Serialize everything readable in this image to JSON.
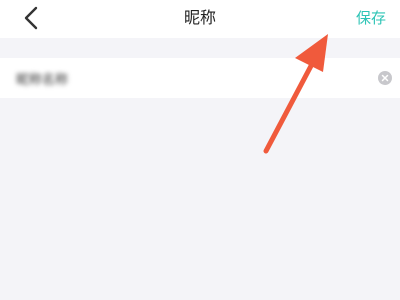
{
  "header": {
    "title": "昵称",
    "save_label": "保存",
    "back_icon": "chevron-left-icon"
  },
  "nickname": {
    "value": "昵称名称",
    "clear_icon": "clear-circle-icon"
  },
  "colors": {
    "accent": "#2ec4b6",
    "arrow": "#f05a3c",
    "background": "#f4f4f8",
    "clear_icon": "#c8c8cc"
  }
}
